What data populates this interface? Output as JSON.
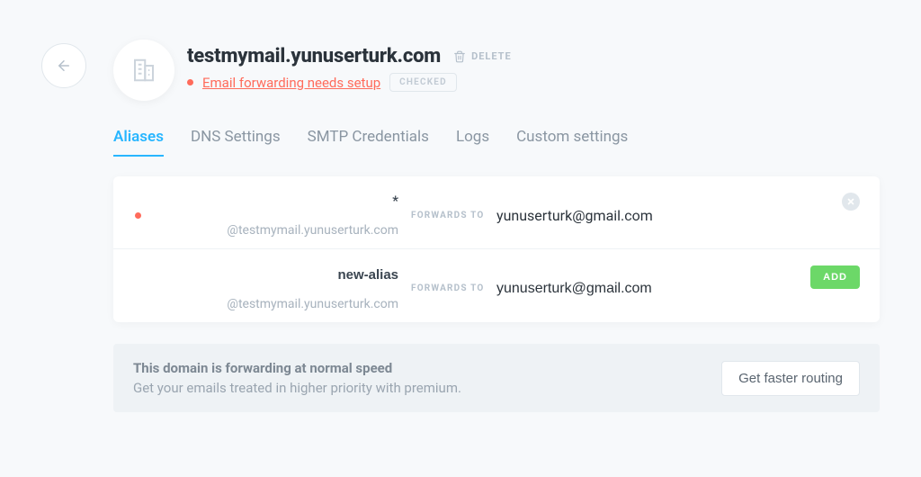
{
  "back_icon": "arrow-left",
  "domain_icon": "building-icon",
  "header": {
    "title": "testmymail.yunuserturk.com",
    "delete_label": "DELETE",
    "status_text": "Email forwarding needs setup",
    "checked_label": "CHECKED"
  },
  "tabs": [
    {
      "label": "Aliases",
      "active": true
    },
    {
      "label": "DNS Settings",
      "active": false
    },
    {
      "label": "SMTP Credentials",
      "active": false
    },
    {
      "label": "Logs",
      "active": false
    },
    {
      "label": "Custom settings",
      "active": false
    }
  ],
  "forwards_label": "FORWARDS TO",
  "at_domain": "@testmymail.yunuserturk.com",
  "aliases": [
    {
      "name": "*",
      "destination": "yunuserturk@gmail.com",
      "status_dot": true,
      "action": "remove"
    },
    {
      "name": "new-alias",
      "destination": "yunuserturk@gmail.com",
      "status_dot": false,
      "action": "add"
    }
  ],
  "add_label": "ADD",
  "banner": {
    "title": "This domain is forwarding at normal speed",
    "subtitle": "Get your emails treated in higher priority with premium.",
    "button": "Get faster routing"
  }
}
